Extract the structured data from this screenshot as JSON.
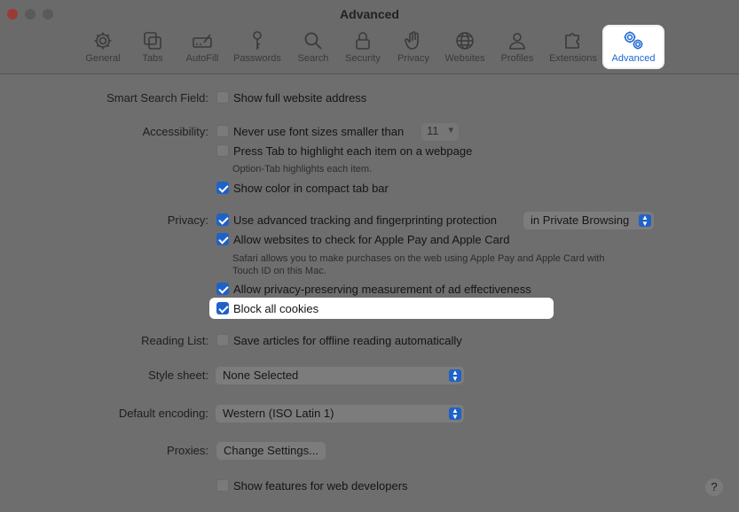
{
  "window": {
    "title": "Advanced"
  },
  "toolbar": {
    "items": [
      {
        "label": "General",
        "icon": "gear-icon"
      },
      {
        "label": "Tabs",
        "icon": "tabs-icon"
      },
      {
        "label": "AutoFill",
        "icon": "pencil-form-icon"
      },
      {
        "label": "Passwords",
        "icon": "key-icon"
      },
      {
        "label": "Search",
        "icon": "search-icon"
      },
      {
        "label": "Security",
        "icon": "lock-icon"
      },
      {
        "label": "Privacy",
        "icon": "hand-icon"
      },
      {
        "label": "Websites",
        "icon": "globe-icon"
      },
      {
        "label": "Profiles",
        "icon": "person-icon"
      },
      {
        "label": "Extensions",
        "icon": "puzzle-icon"
      },
      {
        "label": "Advanced",
        "icon": "gears-icon",
        "active": true
      }
    ]
  },
  "settings": {
    "smart_search": {
      "label": "Smart Search Field:",
      "show_full_address": {
        "text": "Show full website address",
        "checked": false
      }
    },
    "accessibility": {
      "label": "Accessibility:",
      "min_font": {
        "text": "Never use font sizes smaller than",
        "checked": false,
        "value": "11"
      },
      "press_tab": {
        "text": "Press Tab to highlight each item on a webpage",
        "checked": false
      },
      "press_tab_note": "Option-Tab highlights each item.",
      "compact_color": {
        "text": "Show color in compact tab bar",
        "checked": true
      }
    },
    "privacy": {
      "label": "Privacy:",
      "tracking": {
        "text": "Use advanced tracking and fingerprinting protection",
        "checked": true
      },
      "tracking_scope": "in Private Browsing",
      "apple_pay": {
        "text": "Allow websites to check for Apple Pay and Apple Card",
        "checked": true
      },
      "apple_pay_note_1": "Safari allows you to make purchases on the web using Apple Pay and Apple Card with",
      "apple_pay_note_2": "Touch ID on this Mac.",
      "ad_measurement": {
        "text": "Allow privacy-preserving measurement of ad effectiveness",
        "checked": true
      },
      "block_cookies": {
        "text": "Block all cookies",
        "checked": true
      }
    },
    "reading_list": {
      "label": "Reading List:",
      "save_offline": {
        "text": "Save articles for offline reading automatically",
        "checked": false
      }
    },
    "style_sheet": {
      "label": "Style sheet:",
      "value": "None Selected"
    },
    "encoding": {
      "label": "Default encoding:",
      "value": "Western (ISO Latin 1)"
    },
    "proxies": {
      "label": "Proxies:",
      "button": "Change Settings..."
    },
    "developer": {
      "text": "Show features for web developers",
      "checked": false
    }
  },
  "help": {
    "label": "?"
  }
}
